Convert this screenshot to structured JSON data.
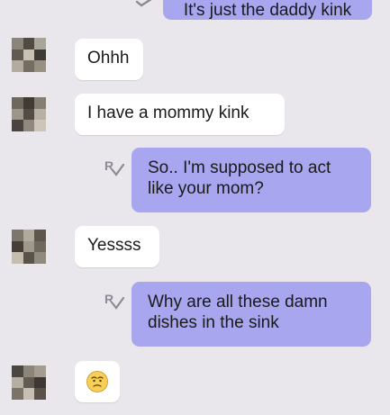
{
  "messages": {
    "m0": {
      "text": "It's just the daddy kink",
      "direction": "outgoing"
    },
    "m1": {
      "text": "Ohhh",
      "direction": "incoming"
    },
    "m2": {
      "text": "I have a mommy kink",
      "direction": "incoming"
    },
    "m3": {
      "text": "So.. I'm supposed to act like your mom?",
      "direction": "outgoing"
    },
    "m4": {
      "text": "Yessss",
      "direction": "incoming"
    },
    "m5": {
      "text": "Why are all these damn dishes in the sink",
      "direction": "outgoing"
    },
    "m6": {
      "emoji": "worried-face",
      "direction": "incoming"
    }
  },
  "colors": {
    "background": "#e9e7ec",
    "incoming_bubble": "#ffffff",
    "outgoing_bubble": "#a9a6f0",
    "read_receipt": "#8b8b96"
  },
  "icons": {
    "read_receipt": "read-receipt-icon",
    "delivered_check": "checkmark-icon",
    "avatar": "pixelated-avatar"
  }
}
